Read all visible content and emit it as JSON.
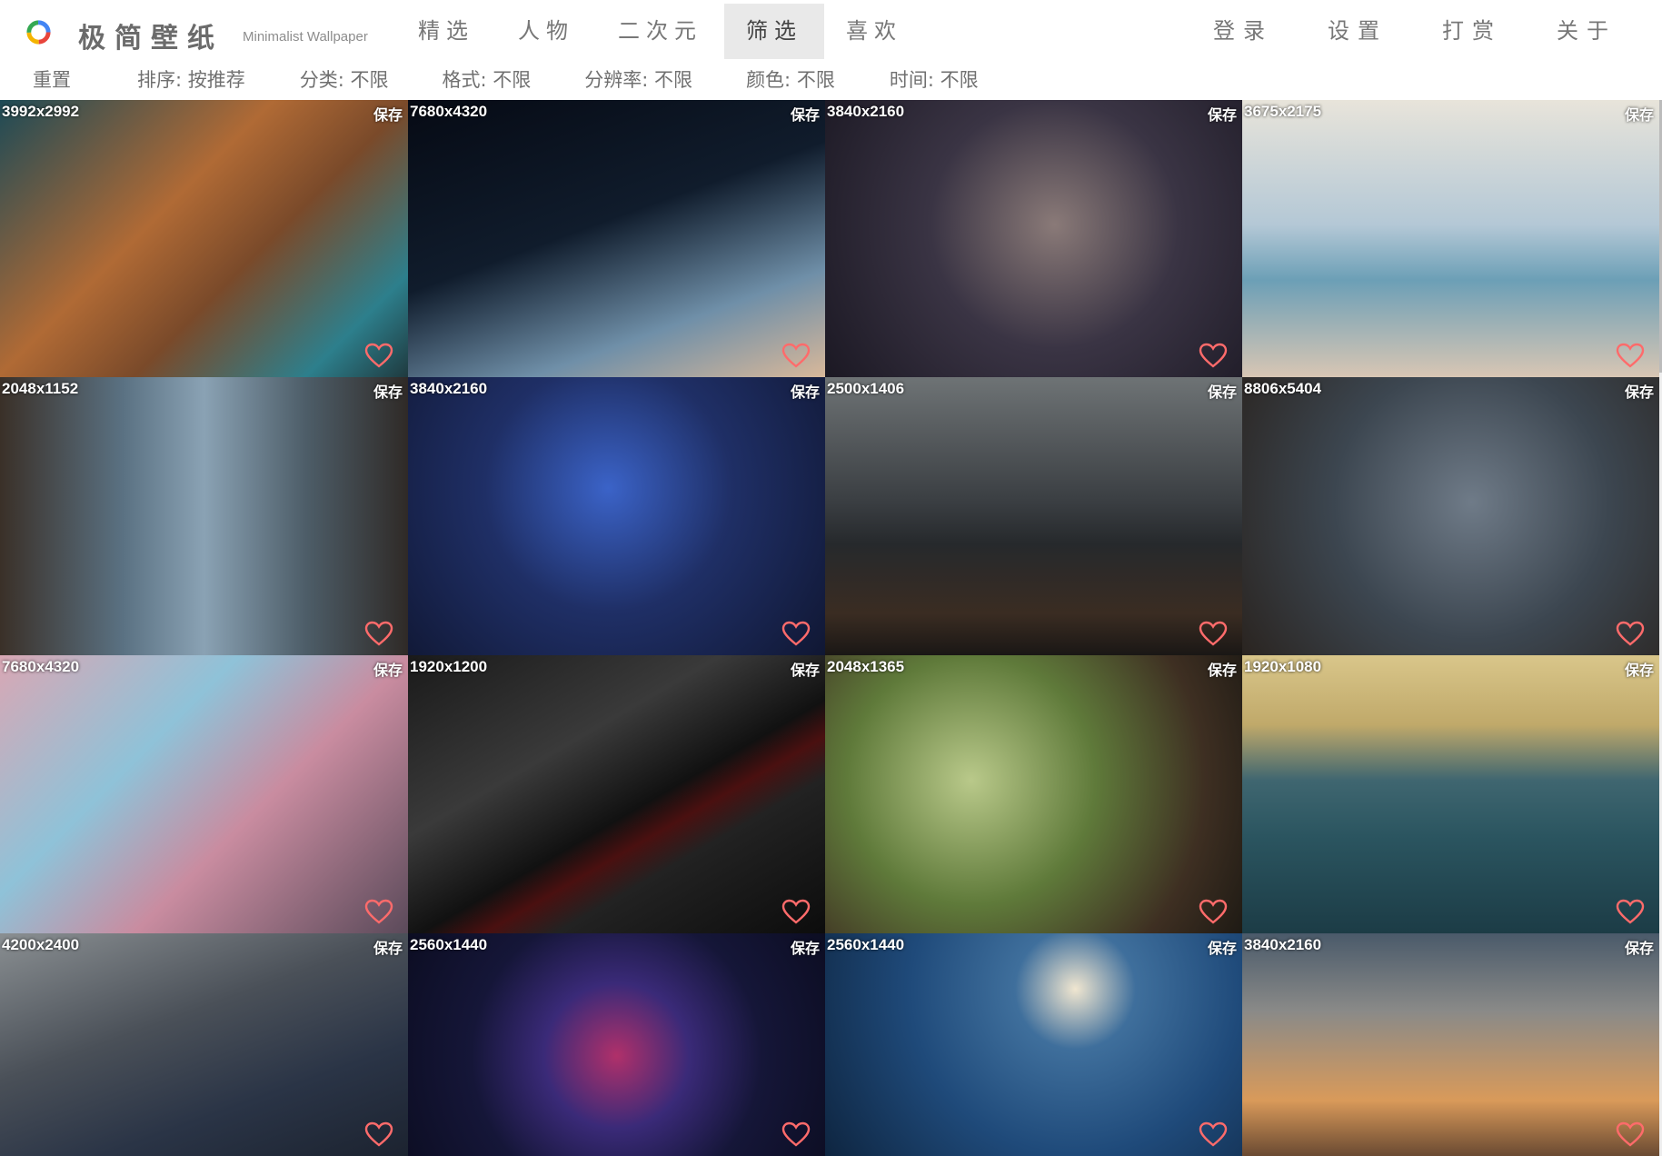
{
  "header": {
    "brand": "极简壁纸",
    "brand_subtitle": "Minimalist Wallpaper",
    "nav": [
      {
        "label": "精选",
        "active": false
      },
      {
        "label": "人物",
        "active": false
      },
      {
        "label": "二次元",
        "active": false
      },
      {
        "label": "筛选",
        "active": true
      },
      {
        "label": "喜欢",
        "active": false
      }
    ],
    "nav_right": [
      {
        "label": "登录"
      },
      {
        "label": "设置"
      },
      {
        "label": "打赏"
      },
      {
        "label": "关于"
      }
    ]
  },
  "filters": {
    "reset": "重置",
    "sort": "排序: 按推荐",
    "category": "分类: 不限",
    "format": "格式: 不限",
    "resolution": "分辨率: 不限",
    "color": "颜色: 不限",
    "time": "时间: 不限"
  },
  "wallpapers": [
    {
      "resolution": "3992x2992",
      "save_label": "保存",
      "icon": "heart-icon",
      "bg": "linear-gradient(135deg,#1d4a56 0%,#b06a35 40%,#7a4a2a 60%,#2d7f8c 85%,#1f3a3f 100%)"
    },
    {
      "resolution": "7680x4320",
      "save_label": "保存",
      "icon": "heart-icon",
      "bg": "linear-gradient(160deg,#060a14 0%,#101c2c 45%,#6f8fa8 75%,#d8b89a 100%)"
    },
    {
      "resolution": "3840x2160",
      "save_label": "保存",
      "icon": "heart-icon",
      "bg": "radial-gradient(circle at 55% 45%,#8a7a78 0%,#3a3444 45%,#1b1823 100%)"
    },
    {
      "resolution": "3675x2175",
      "save_label": "保存",
      "icon": "heart-icon",
      "bg": "linear-gradient(180deg,#e8e4da 0%,#b4c8d6 45%,#6c9fb6 65%,#d8c6b4 100%)"
    },
    {
      "resolution": "2048x1152",
      "save_label": "保存",
      "icon": "heart-icon",
      "bg": "linear-gradient(90deg,#3a3028 0%,#5a7182 30%,#8aa2b4 50%,#4d5d68 75%,#2f2a27 100%)"
    },
    {
      "resolution": "3840x2160",
      "save_label": "保存",
      "icon": "heart-icon",
      "bg": "radial-gradient(circle at 48% 40%,#3b63c8 0%,#1f2f66 45%,#101733 100%)"
    },
    {
      "resolution": "2500x1406",
      "save_label": "保存",
      "icon": "heart-icon",
      "bg": "linear-gradient(180deg,#6e7375 0%,#3a3e42 45%,#26292c 60%,#3a2c22 85%,#1a1715 100%)"
    },
    {
      "resolution": "8806x5404",
      "save_label": "保存",
      "icon": "heart-icon",
      "bg": "radial-gradient(circle at 55% 45%,#6f7b88 0%,#3c4650 50%,#2a2420 100%)"
    },
    {
      "resolution": "7680x4320",
      "save_label": "保存",
      "icon": "heart-icon",
      "bg": "linear-gradient(135deg,#d9a7b4 0%,#8fc2d8 35%,#c98ca0 60%,#5b4a5a 100%)"
    },
    {
      "resolution": "1920x1200",
      "save_label": "保存",
      "icon": "heart-icon",
      "bg": "linear-gradient(150deg,#1a1a1a 0%,#3a3a3a 35%,#111 55%,#4a1010 62%,#222 70%,#0c0c0c 100%)"
    },
    {
      "resolution": "2048x1365",
      "save_label": "保存",
      "icon": "heart-icon",
      "bg": "radial-gradient(circle at 35% 45%,#b9c98a 0%,#5f7a3a 40%,#3e2f22 75%,#1e1a14 100%)"
    },
    {
      "resolution": "1920x1080",
      "save_label": "保存",
      "icon": "heart-icon",
      "bg": "linear-gradient(180deg,#d9c68a 0%,#c0a96a 25%,#3f6670 45%,#2b5560 65%,#1c3c46 100%)"
    },
    {
      "resolution": "4200x2400",
      "save_label": "保存",
      "icon": "heart-icon",
      "bg": "linear-gradient(160deg,#8a8f92 0%,#4a5058 40%,#2a3446 70%,#1c2330 100%)"
    },
    {
      "resolution": "2560x1440",
      "save_label": "保存",
      "icon": "heart-icon",
      "bg": "radial-gradient(circle at 50% 55%,#b0306a 0%,#3a2a78 30%,#151638 60%,#0c0d22 100%)"
    },
    {
      "resolution": "2560x1440",
      "save_label": "保存",
      "icon": "heart-icon",
      "bg": "radial-gradient(circle at 60% 25%,#f0e6d0 0%,#3f6f9c 20%,#1f4a7a 55%,#0e2540 100%)"
    },
    {
      "resolution": "3840x2160",
      "save_label": "保存",
      "icon": "heart-icon",
      "bg": "linear-gradient(180deg,#4a5a6a 0%,#8a8a88 35%,#d99a5a 75%,#6a4a32 100%)"
    }
  ],
  "colors": {
    "heart_stroke": "#ff6b6b",
    "active_nav_bg": "#e9e9e9",
    "logo_red": "#e8453c",
    "logo_yellow": "#f4b400",
    "logo_green": "#34a853",
    "logo_blue": "#4285f4"
  }
}
